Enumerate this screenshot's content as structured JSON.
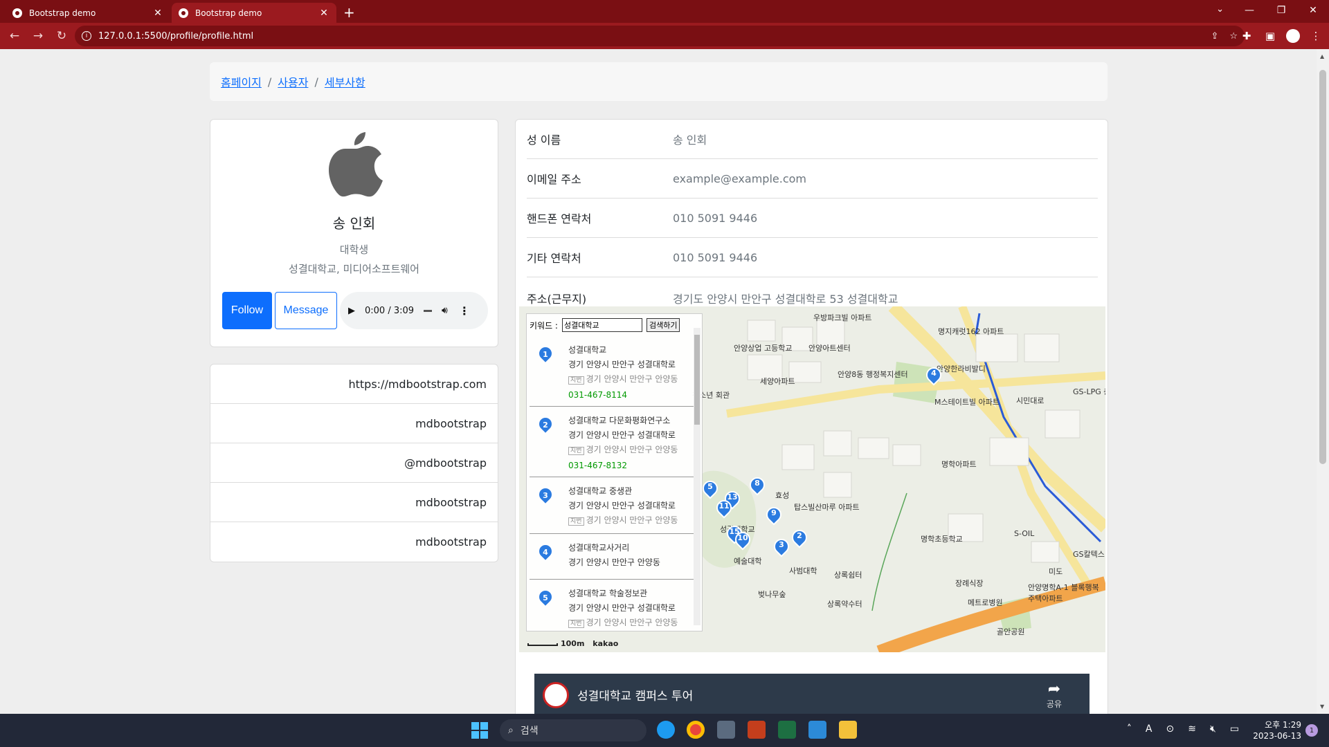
{
  "browser": {
    "tabs": [
      {
        "title": "Bootstrap demo",
        "active": false
      },
      {
        "title": "Bootstrap demo",
        "active": true
      }
    ],
    "url": "127.0.0.1:5500/profile/profile.html"
  },
  "breadcrumb": [
    "홈페이지",
    "사용자",
    "세부사항"
  ],
  "profile": {
    "name": "송 인회",
    "role": "대학생",
    "school": "성결대학교, 미디어소프트웨어",
    "follow_label": "Follow",
    "message_label": "Message",
    "audio_time": "0:00 / 3:09"
  },
  "links": [
    "https://mdbootstrap.com",
    "mdbootstrap",
    "@mdbootstrap",
    "mdbootstrap",
    "mdbootstrap"
  ],
  "info": [
    {
      "label": "성 이름",
      "value": "송 인회"
    },
    {
      "label": "이메일 주소",
      "value": "example@example.com"
    },
    {
      "label": "핸드폰 연락처",
      "value": "010 5091 9446"
    },
    {
      "label": "기타 연락처",
      "value": "010 5091 9446"
    },
    {
      "label": "주소(근무지)",
      "value": "경기도 안양시 만안구 성결대학로 53 성결대학교"
    }
  ],
  "map": {
    "keyword_label": "키워드 :",
    "keyword_value": "성결대학교",
    "search_button": "검색하기",
    "results": [
      {
        "num": "1",
        "title": "성결대학교",
        "addr": "경기 안양시 만안구 성결대학로",
        "jibun": "경기 안양시 만안구 안양동",
        "phone": "031-467-8114"
      },
      {
        "num": "2",
        "title": "성결대학교 다문화평화연구소",
        "addr": "경기 안양시 만안구 성결대학로",
        "jibun": "경기 안양시 만안구 안양동",
        "phone": "031-467-8132"
      },
      {
        "num": "3",
        "title": "성결대학교 중생관",
        "addr": "경기 안양시 만안구 성결대학로",
        "jibun": "경기 안양시 만안구 안양동",
        "phone": ""
      },
      {
        "num": "4",
        "title": "성결대학교사거리",
        "addr": "경기 안양시 만안구 안양동",
        "jibun": "",
        "phone": ""
      },
      {
        "num": "5",
        "title": "성결대학교 학술정보관",
        "addr": "경기 안양시 만안구 성결대학로",
        "jibun": "경기 안양시 만안구 안양동",
        "phone": ""
      }
    ],
    "jibun_badge": "지번",
    "scale": "100m",
    "brand": "kakao",
    "labels": [
      "우방파크빌 아파트",
      "안양아트센터",
      "안양상업 고등학교",
      "안양8동 행정복지센터",
      "세양아파트",
      "안양한라비발디",
      "M스테이트빌 아파트",
      "GS-LPG 충전소",
      "명지캐럿162 아파트",
      "명학아파트",
      "성결대학교",
      "예술대학",
      "사범대학",
      "탑스빌산마루 아파트",
      "명학초등학교",
      "S-OIL",
      "GS칼텍스",
      "미도",
      "상록쉼터",
      "벚나무숲",
      "상록약수터",
      "장례식장",
      "메트로병원",
      "안양명학A-1 블록행복주택아파트",
      "골안공원",
      "효성",
      "시민대로",
      "청소년 회관"
    ],
    "markers": [
      "4",
      "5",
      "8",
      "13",
      "11",
      "9",
      "15",
      "10",
      "3",
      "2"
    ]
  },
  "video": {
    "title": "성결대학교 캠퍼스 투어",
    "share_label": "공유"
  },
  "taskbar": {
    "search_placeholder": "검색",
    "time": "오후 1:29",
    "date": "2023-06-13",
    "notifications": "1"
  },
  "colors": {
    "browser_frame": "#7a0f13",
    "primary": "#0d6efd",
    "phone_green": "#009900",
    "marker_blue": "#2b7be0"
  }
}
